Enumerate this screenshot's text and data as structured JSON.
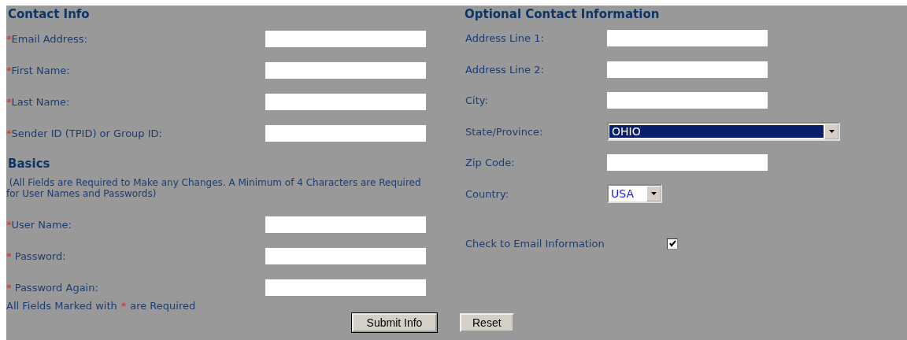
{
  "contact": {
    "heading": "Contact Info",
    "fields": [
      {
        "marker": "*",
        "label": "Email Address:"
      },
      {
        "marker": "*",
        "label": "First Name:"
      },
      {
        "marker": "*",
        "label": "Last Name:"
      },
      {
        "marker": "*",
        "label": "Sender ID (TPID) or Group ID:"
      }
    ]
  },
  "basics": {
    "heading": "Basics",
    "note": " (All Fields are Required to Make any Changes. A Minimum of 4 Characters are Required for User Names and Passwords)",
    "fields": [
      {
        "marker": "*",
        "label": "User Name:"
      },
      {
        "marker": "*",
        "label": " Password:"
      },
      {
        "marker": "*",
        "label": " Password Again:"
      }
    ],
    "footnote": {
      "before": "All Fields Marked with",
      "marker": "*",
      "after": "are Required"
    }
  },
  "optional": {
    "heading": "Optional Contact Information",
    "fields": [
      {
        "kind": "text",
        "label": "Address Line 1:"
      },
      {
        "kind": "text",
        "label": "Address Line 2:"
      },
      {
        "kind": "text",
        "label": "City:"
      },
      {
        "kind": "select",
        "label": "State/Province:",
        "value": "OHIO",
        "focused": true
      },
      {
        "kind": "text",
        "label": "Zip Code:"
      },
      {
        "kind": "select",
        "label": "Country:",
        "value": "USA",
        "focused": false
      }
    ],
    "email_check": {
      "label": "Check to Email Information",
      "checked": true
    }
  },
  "buttons": [
    "Submit Info",
    "Reset"
  ]
}
